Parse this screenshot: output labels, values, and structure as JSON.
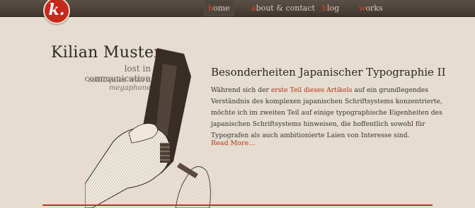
{
  "logo": {
    "text": "k."
  },
  "nav": [
    {
      "first": "h",
      "rest": "ome",
      "active": true
    },
    {
      "first": "a",
      "rest": "bout & contact",
      "active": false
    },
    {
      "first": "b",
      "rest": "log",
      "active": false
    },
    {
      "first": "w",
      "rest": "orks",
      "active": false
    }
  ],
  "author": {
    "name": "Kilian Muster",
    "tagline": "lost in communication",
    "subtagline": "soliloquies with a megaphone"
  },
  "post": {
    "title": "Besonderheiten Japanischer Typographie II",
    "body_before": "Während sich der ",
    "link_text": "erste Teil dieses Artikels",
    "body_after": " auf ein grundlegendes Verständnis des komplexen japanischen Schriftsystems konzentrierte, möchte ich im zweiten Teil auf einige typographische Eigenheiten des japanischen Schriftsystems hinweisen, die hoffentlich sowohl für Typografen als auch ambitionierte Laien von Interesse sind.",
    "read_more": "Read More…"
  },
  "colors": {
    "accent": "#c42a1c",
    "background": "#e4ddd0",
    "nav_bar": "#4a4138"
  }
}
